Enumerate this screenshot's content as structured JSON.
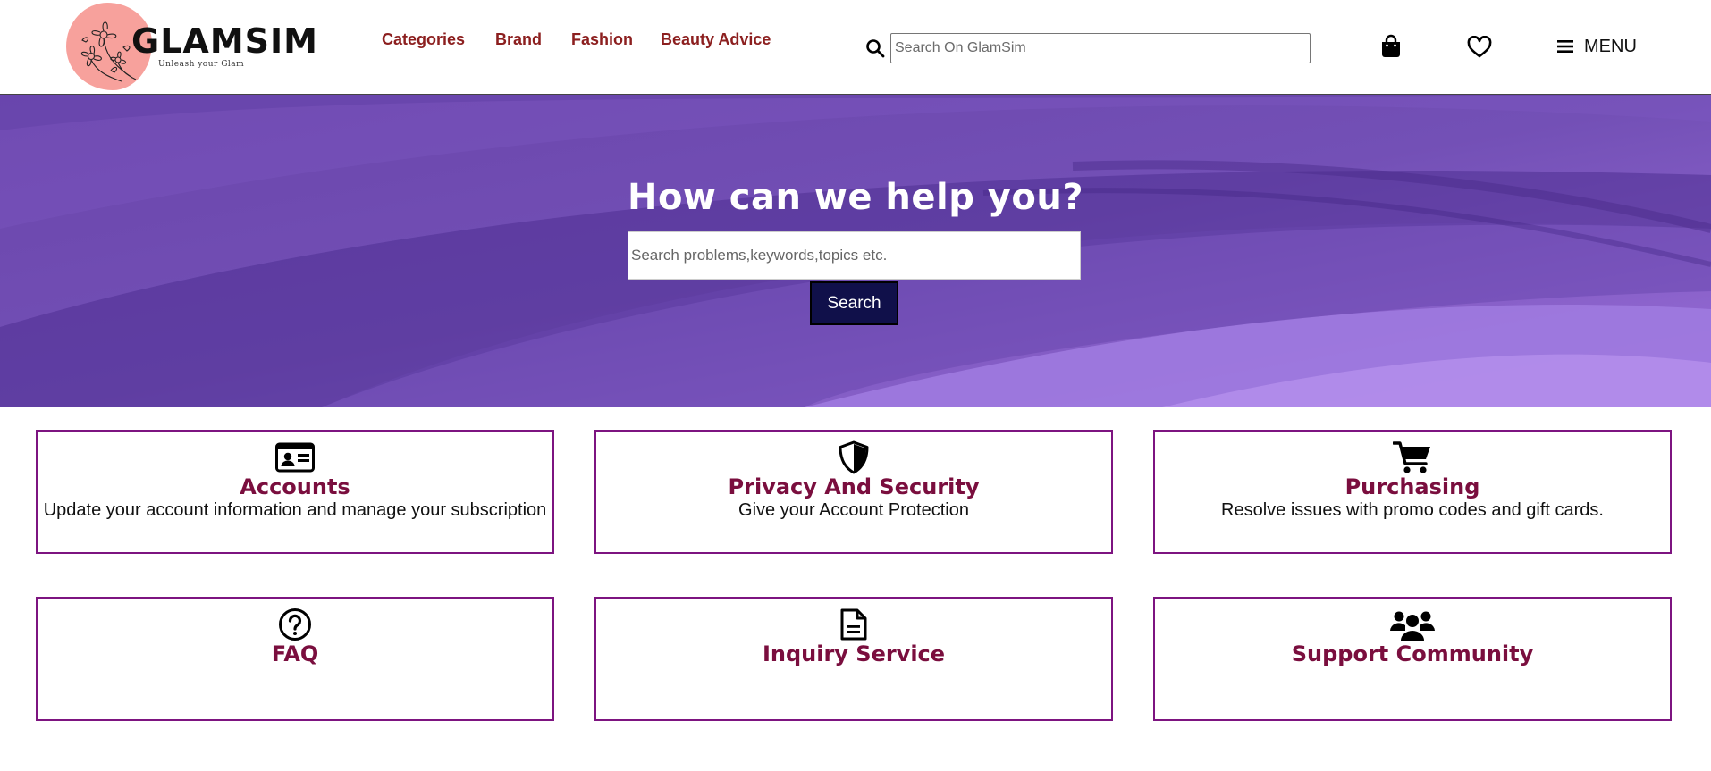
{
  "brand": {
    "name": "GLAMSIM",
    "tagline": "Unleash your Glam"
  },
  "nav": {
    "categories": "Categories",
    "brand": "Brand",
    "fashion": "Fashion",
    "beauty_advice": "Beauty Advice"
  },
  "search": {
    "placeholder": "Search On GlamSim",
    "icon": "search-icon"
  },
  "header_icons": {
    "bag": "shopping-bag-icon",
    "wishlist": "heart-icon"
  },
  "menu": {
    "label": "MENU",
    "icon": "hamburger-icon"
  },
  "hero": {
    "title": "How can we help you?",
    "search_placeholder": "Search problems,keywords,topics etc.",
    "button_label": "Search"
  },
  "help_topics": [
    {
      "icon": "id-card-icon",
      "title": "Accounts",
      "description": "Update your account information and manage your subscription"
    },
    {
      "icon": "shield-icon",
      "title": "Privacy And Security",
      "description": "Give your Account Protection"
    },
    {
      "icon": "shopping-cart-icon",
      "title": "Purchasing",
      "description": "Resolve issues with promo codes and gift cards."
    },
    {
      "icon": "question-circle-icon",
      "title": "FAQ",
      "description": ""
    },
    {
      "icon": "document-icon",
      "title": "Inquiry Service",
      "description": ""
    },
    {
      "icon": "users-icon",
      "title": "Support Community",
      "description": ""
    }
  ],
  "colors": {
    "nav_text": "#8c1f1f",
    "card_border": "#7d1480",
    "card_title": "#7a0e3e",
    "hero_bg": "#6f4bb0",
    "hero_button": "#10104a",
    "logo_blob": "#f7a19c"
  }
}
